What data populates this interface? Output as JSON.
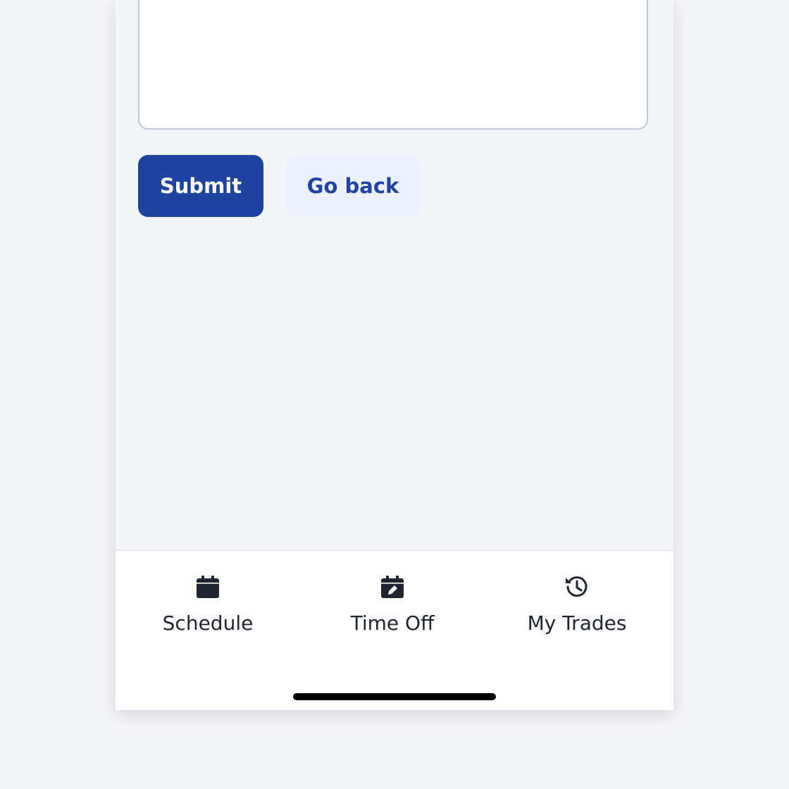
{
  "form": {
    "comment_value": "",
    "submit_label": "Submit",
    "back_label": "Go back"
  },
  "tabbar": {
    "tabs": [
      {
        "label": "Schedule",
        "icon": "calendar-icon"
      },
      {
        "label": "Time Off",
        "icon": "calendar-edit-icon"
      },
      {
        "label": "My Trades",
        "icon": "history-icon"
      }
    ]
  },
  "colors": {
    "primary": "#1f43a0",
    "secondary_button_bg": "#ecf1fd",
    "page_bg": "#f4f5f9",
    "text": "#1f2430"
  }
}
